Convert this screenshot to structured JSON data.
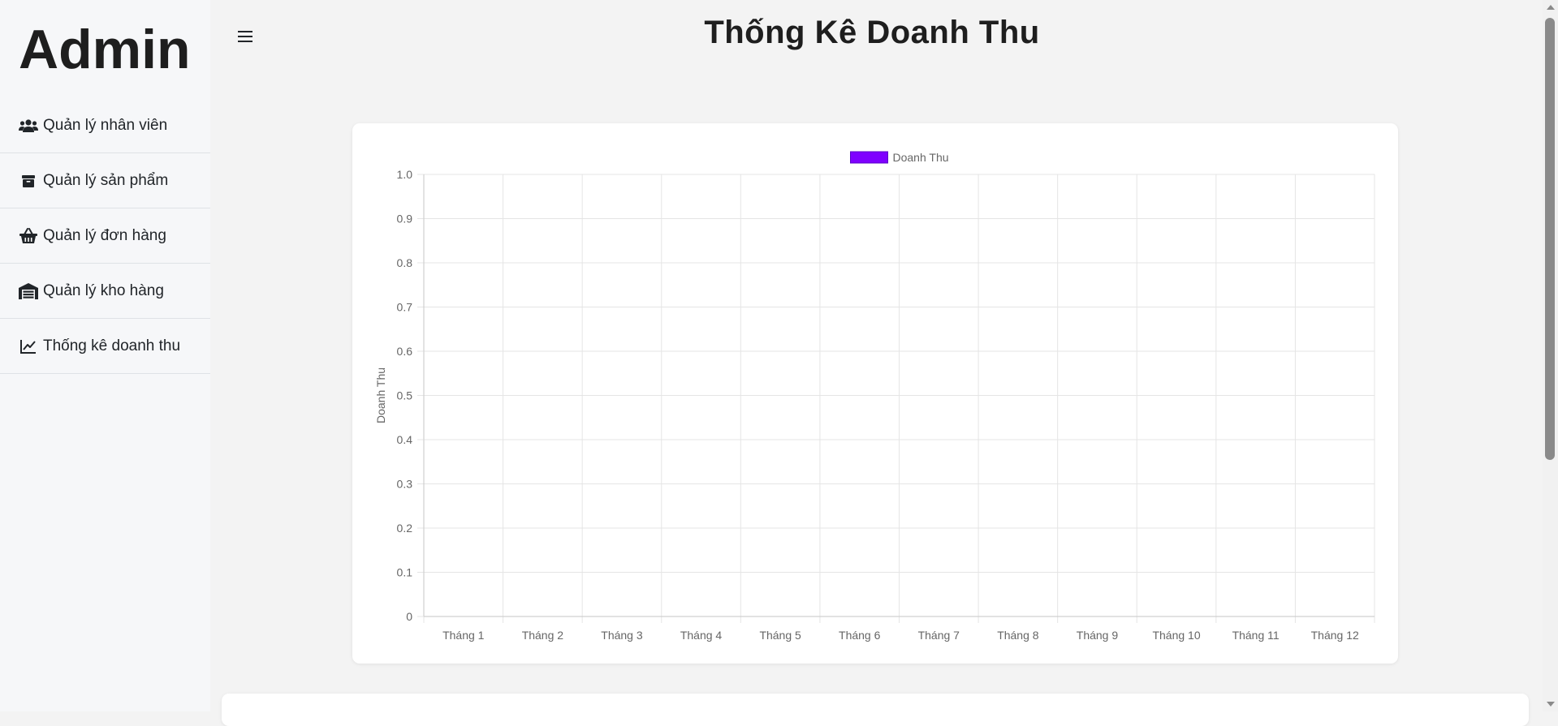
{
  "sidebar": {
    "brand": "Admin",
    "items": [
      {
        "label": "Quản lý nhân viên",
        "icon": "users-icon"
      },
      {
        "label": "Quản lý sản phẩm",
        "icon": "box-icon"
      },
      {
        "label": "Quản lý đơn hàng",
        "icon": "basket-icon"
      },
      {
        "label": "Quản lý kho hàng",
        "icon": "warehouse-icon"
      },
      {
        "label": "Thống kê doanh thu",
        "icon": "chart-line-icon"
      }
    ]
  },
  "header": {
    "menu_icon": "hamburger-icon",
    "title": "Thống Kê Doanh Thu"
  },
  "colors": {
    "series": "#7f00ff",
    "grid": "#e5e5e5",
    "tick_text": "#666666"
  },
  "chart_data": {
    "type": "bar",
    "title": "",
    "categories": [
      "Tháng 1",
      "Tháng 2",
      "Tháng 3",
      "Tháng 4",
      "Tháng 5",
      "Tháng 6",
      "Tháng 7",
      "Tháng 8",
      "Tháng 9",
      "Tháng 10",
      "Tháng 11",
      "Tháng 12"
    ],
    "series": [
      {
        "name": "Doanh Thu",
        "values": [],
        "color": "#7f00ff"
      }
    ],
    "ylabel": "Doanh Thu",
    "xlabel": "",
    "ylim": [
      0,
      1.0
    ],
    "yticks": [
      "0",
      "0.1",
      "0.2",
      "0.3",
      "0.4",
      "0.5",
      "0.6",
      "0.7",
      "0.8",
      "0.9",
      "1.0"
    ],
    "grid": true,
    "legend_position": "top"
  }
}
